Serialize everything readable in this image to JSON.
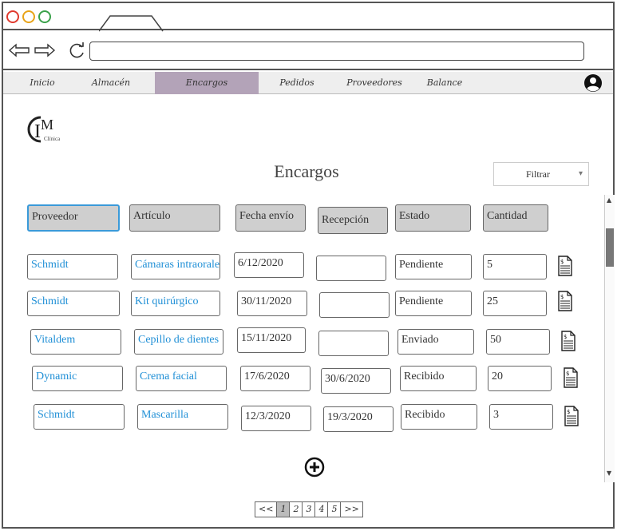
{
  "menu": {
    "items": [
      "Inicio",
      "Almacén",
      "Encargos",
      "Pedidos",
      "Proveedores",
      "Balance"
    ],
    "active": "Encargos"
  },
  "logo": {
    "letters": "IMC",
    "small_text": "Clínica"
  },
  "page": {
    "title": "Encargos"
  },
  "filter": {
    "label": "Filtrar"
  },
  "table": {
    "headers": [
      "Proveedor",
      "Artículo",
      "Fecha envío",
      "Recepción",
      "Estado",
      "Cantidad"
    ],
    "rows": [
      {
        "proveedor": "Schmidt",
        "articulo": "Cámaras intraorales",
        "envio": "6/12/2020",
        "recepcion": "",
        "estado": "Pendiente",
        "cantidad": "5"
      },
      {
        "proveedor": "Schmidt",
        "articulo": "Kit quirúrgico",
        "envio": "30/11/2020",
        "recepcion": "",
        "estado": "Pendiente",
        "cantidad": "25"
      },
      {
        "proveedor": "Vitaldem",
        "articulo": "Cepillo de dientes",
        "envio": "15/11/2020",
        "recepcion": "",
        "estado": "Enviado",
        "cantidad": "50"
      },
      {
        "proveedor": "Dynamic",
        "articulo": "Crema facial",
        "envio": "17/6/2020",
        "recepcion": "30/6/2020",
        "estado": "Recibido",
        "cantidad": "20"
      },
      {
        "proveedor": "Schmidt",
        "articulo": "Mascarilla",
        "envio": "12/3/2020",
        "recepcion": "19/3/2020",
        "estado": "Recibido",
        "cantidad": "3"
      }
    ]
  },
  "pagination": {
    "items": [
      "<<",
      "1",
      "2",
      "3",
      "4",
      "5",
      ">>"
    ],
    "current": "1"
  },
  "icons": {
    "user": "user-icon",
    "add": "plus-circle-icon",
    "document": "document-icon"
  }
}
